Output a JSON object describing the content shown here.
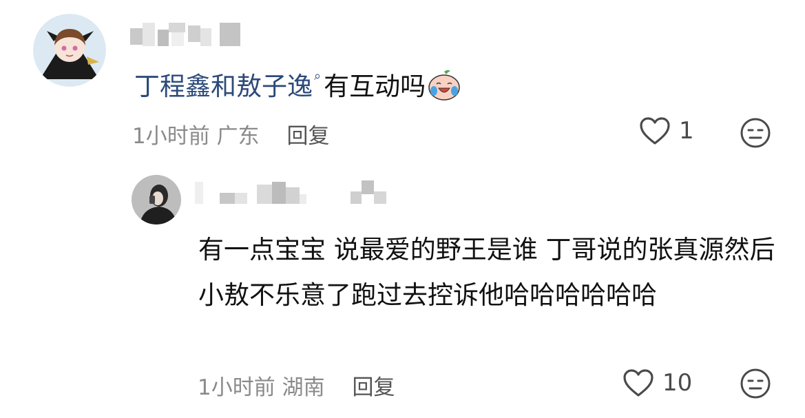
{
  "comment": {
    "mention": "丁程鑫和敖子逸",
    "text": "有互动吗",
    "emoji_icon": "crying-laughing-peach-emoji",
    "time": "1小时前",
    "location": "广东",
    "reply_label": "回复",
    "like_count": "1"
  },
  "reply": {
    "text": "有一点宝宝 说最爱的野王是谁 丁哥说的张真源然后小敖不乐意了跑过去控诉他哈哈哈哈哈哈",
    "time": "1小时前",
    "location": "湖南",
    "reply_label": "回复",
    "like_count": "10"
  },
  "colors": {
    "mention": "#2c4a7a",
    "meta": "#8a8a8a",
    "icon": "#4a4a4a"
  }
}
